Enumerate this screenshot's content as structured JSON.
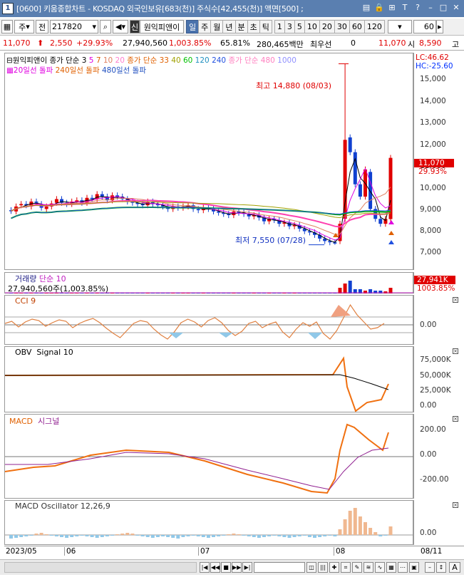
{
  "window": {
    "number": "1",
    "title": "[0600] 키움종합차트 - KOSDAQ 외국인보유[683(천)] 주식수[42,455(천)] 액면[500] ;"
  },
  "toolbar": {
    "period_type": "주",
    "prev_label": "전",
    "stock_code": "217820",
    "stock_name": "원익피앤이",
    "badge": "신",
    "periods": [
      "일",
      "주",
      "월",
      "년",
      "분",
      "초",
      "틱"
    ],
    "active_period": "일",
    "intervals": [
      "1",
      "3",
      "5",
      "10",
      "20",
      "30",
      "60",
      "120"
    ],
    "count": "60"
  },
  "info": {
    "price": "11,070",
    "change": "2,550",
    "change_pct": "+29.93%",
    "volume": "27,940,560",
    "vol_ratio": "1,003.85%",
    "turnover": "65.81%",
    "amount": "280,465백만",
    "priority": "최우선",
    "zero": "0",
    "ask": "11,070",
    "open_label": "시",
    "open": "8,590",
    "high_label": "고"
  },
  "price_panel": {
    "legend1": [
      "원익피앤이",
      "종가 단순 3",
      "5",
      "7",
      "10",
      "20",
      "종가 단순 33",
      "40",
      "60",
      "120",
      "240",
      "종가 단순 480",
      "1000"
    ],
    "legend2": [
      "20일선 돌파",
      "240일선 돌파",
      "480일선 돌파"
    ],
    "lc": "LC:46.62",
    "hc": "HC:-25.60",
    "high_note": "최고 14,880 (08/03)",
    "low_note": "최저 7,550 (07/28)",
    "last_price": "11,070",
    "last_pct": "29.93%",
    "yticks": [
      "15,000",
      "14,000",
      "13,000",
      "12,000",
      "11,000",
      "10,000",
      "9,000",
      "8,000",
      "7,000"
    ]
  },
  "volume_panel": {
    "label": "거래량",
    "ma_label": "단순 10",
    "value": "27,940,560주(1,003.85%)",
    "last": "27,941K",
    "last_pct": "1003.85%"
  },
  "cci_panel": {
    "label": "CCI 9",
    "ytick": "0.00"
  },
  "obv_panel": {
    "label": "OBV",
    "signal": "Signal 10",
    "yticks": [
      "75,000K",
      "50,000K",
      "25,000K",
      "0.00"
    ]
  },
  "macd_panel": {
    "label": "MACD",
    "signal": "시그널",
    "yticks": [
      "200.00",
      "0.00",
      "-200.00"
    ]
  },
  "osc_panel": {
    "label": "MACD Oscillator 12,26,9",
    "ytick": "0.00"
  },
  "xaxis": {
    "labels": [
      "2023/05",
      "06",
      "07",
      "08"
    ],
    "right": "08/11"
  },
  "colors": {
    "up": "#e00000",
    "down": "#1040d0",
    "macd": "#f07010",
    "signal": "#9020a0",
    "osc": "#f0b890",
    "osc_neg": "#90c8e8"
  }
}
